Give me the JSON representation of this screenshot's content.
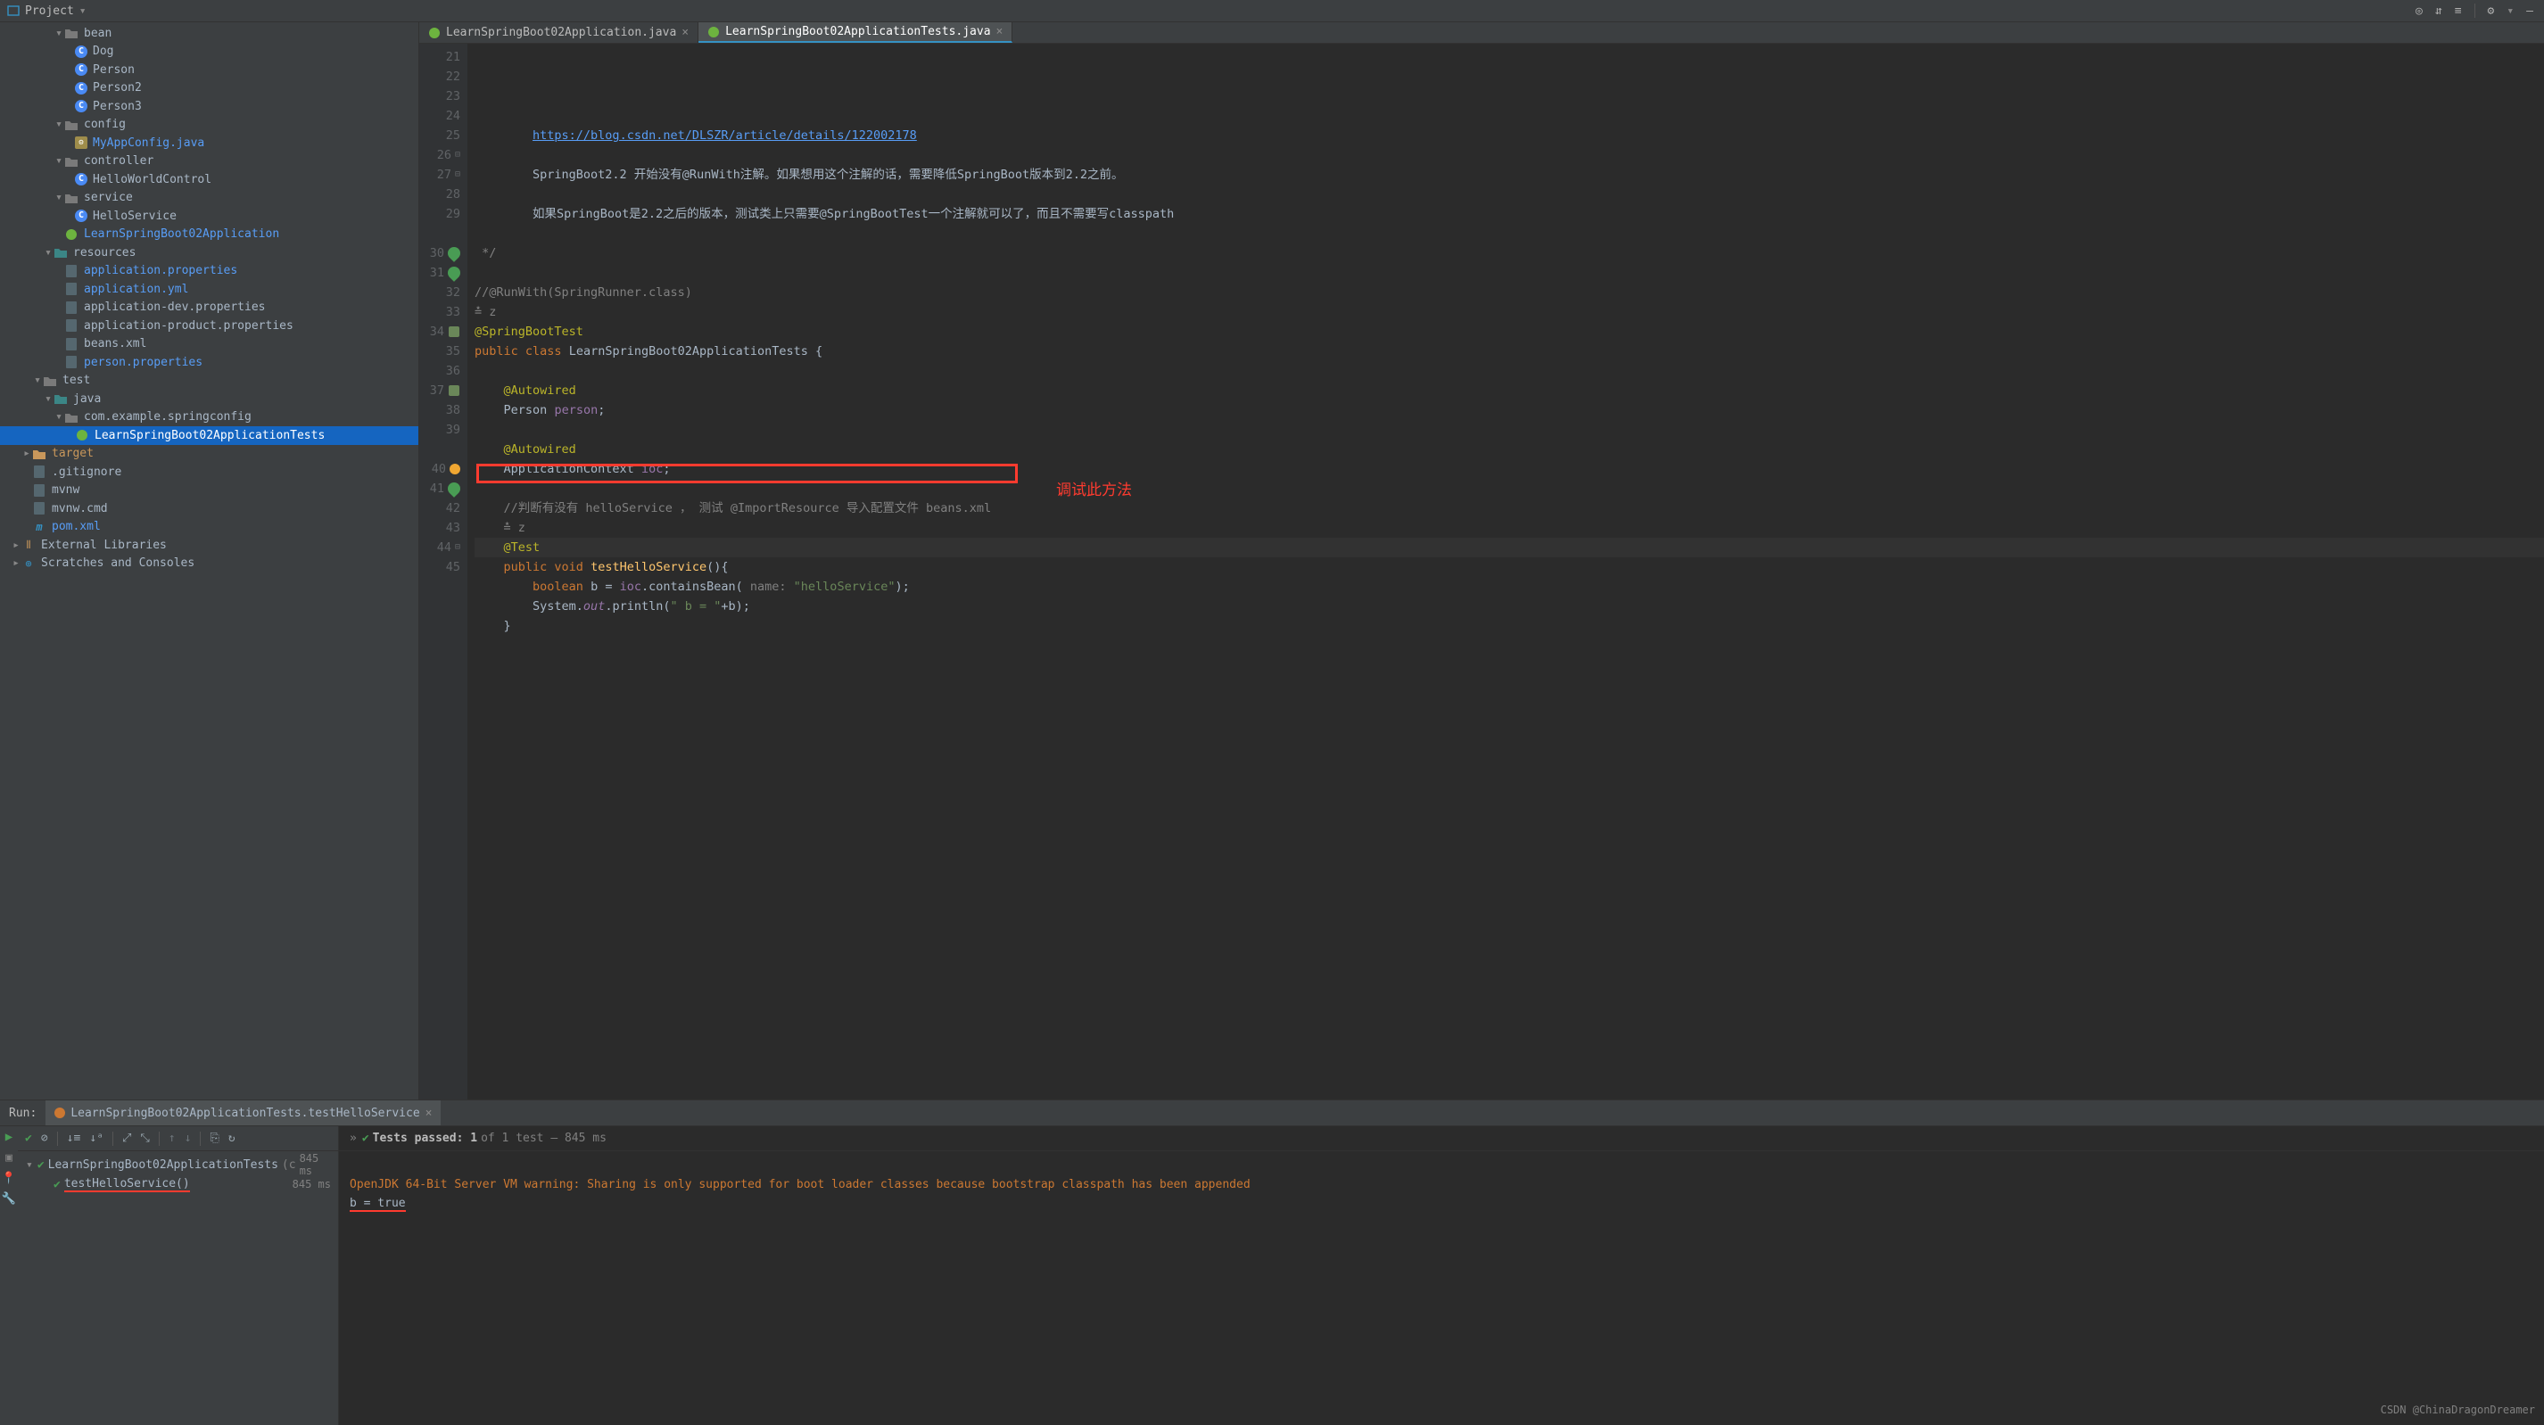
{
  "topbar": {
    "project_label": "Project"
  },
  "project_tree": {
    "items": [
      {
        "depth": 4,
        "caret": "v",
        "icoCls": "fi-dir",
        "label": "bean"
      },
      {
        "depth": 5,
        "caret": "",
        "icoCls": "fi-class",
        "label": "Dog"
      },
      {
        "depth": 5,
        "caret": "",
        "icoCls": "fi-class",
        "label": "Person"
      },
      {
        "depth": 5,
        "caret": "",
        "icoCls": "fi-class",
        "label": "Person2"
      },
      {
        "depth": 5,
        "caret": "",
        "icoCls": "fi-class",
        "label": "Person3"
      },
      {
        "depth": 4,
        "caret": "v",
        "icoCls": "fi-dir",
        "label": "config"
      },
      {
        "depth": 5,
        "caret": "",
        "icoCls": "fi-cfg",
        "label": "MyAppConfig.java",
        "labelCls": "hl-blue"
      },
      {
        "depth": 4,
        "caret": "v",
        "icoCls": "fi-dir",
        "label": "controller"
      },
      {
        "depth": 5,
        "caret": "",
        "icoCls": "fi-class",
        "label": "HelloWorldControl"
      },
      {
        "depth": 4,
        "caret": "v",
        "icoCls": "fi-dir",
        "label": "service"
      },
      {
        "depth": 5,
        "caret": "",
        "icoCls": "fi-class",
        "label": "HelloService"
      },
      {
        "depth": 4,
        "caret": "",
        "icoCls": "fi-class",
        "label": "LearnSpringBoot02Application",
        "labelCls": "hl-blue",
        "greenIco": true
      },
      {
        "depth": 3,
        "caret": "v",
        "icoCls": "fi-dir src",
        "label": "resources"
      },
      {
        "depth": 4,
        "caret": "",
        "icoCls": "fi-res",
        "label": "application.properties",
        "labelCls": "hl-blue"
      },
      {
        "depth": 4,
        "caret": "",
        "icoCls": "fi-res",
        "label": "application.yml",
        "labelCls": "hl-blue"
      },
      {
        "depth": 4,
        "caret": "",
        "icoCls": "fi-res",
        "label": "application-dev.properties"
      },
      {
        "depth": 4,
        "caret": "",
        "icoCls": "fi-res",
        "label": "application-product.properties"
      },
      {
        "depth": 4,
        "caret": "",
        "icoCls": "fi-res",
        "label": "beans.xml"
      },
      {
        "depth": 4,
        "caret": "",
        "icoCls": "fi-res",
        "label": "person.properties",
        "labelCls": "hl-blue"
      },
      {
        "depth": 2,
        "caret": "v",
        "icoCls": "fi-dir",
        "label": "test"
      },
      {
        "depth": 3,
        "caret": "v",
        "icoCls": "fi-dir src",
        "label": "java"
      },
      {
        "depth": 4,
        "caret": "v",
        "icoCls": "fi-dir",
        "label": "com.example.springconfig"
      },
      {
        "depth": 5,
        "caret": "",
        "icoCls": "fi-class",
        "label": "LearnSpringBoot02ApplicationTests",
        "selected": true,
        "greenIco": true
      },
      {
        "depth": 1,
        "caret": ">",
        "icoCls": "fi-dir",
        "label": "target",
        "labelCls": "hl-tan"
      },
      {
        "depth": 1,
        "caret": "",
        "icoCls": "",
        "label": ".gitignore"
      },
      {
        "depth": 1,
        "caret": "",
        "icoCls": "",
        "label": "mvnw"
      },
      {
        "depth": 1,
        "caret": "",
        "icoCls": "",
        "label": "mvnw.cmd"
      },
      {
        "depth": 1,
        "caret": "",
        "icoCls": "",
        "label": "pom.xml",
        "labelCls": "hl-blue",
        "mvn": true
      },
      {
        "depth": 0,
        "caret": ">",
        "icoCls": "",
        "label": "External Libraries",
        "lib": true
      },
      {
        "depth": 0,
        "caret": ">",
        "icoCls": "",
        "label": "Scratches and Consoles",
        "scratch": true
      }
    ]
  },
  "editor": {
    "tabs": [
      {
        "label": "LearnSpringBoot02Application.java",
        "active": false
      },
      {
        "label": "LearnSpringBoot02ApplicationTests.java",
        "active": true
      }
    ],
    "gutter_start": 21,
    "lines": [
      {
        "n": 21,
        "html": "        <span class='lnk'>https://blog.csdn.net/DLSZR/article/details/122002178</span>"
      },
      {
        "n": 22,
        "html": ""
      },
      {
        "n": 23,
        "html": "        SpringBoot2.2 开始没有@RunWith注解。如果想用这个注解的话，需要降低SpringBoot版本到2.2之前。"
      },
      {
        "n": 24,
        "html": ""
      },
      {
        "n": 25,
        "html": "        如果SpringBoot是2.2之后的版本，测试类上只需要@SpringBootTest一个注解就可以了，而且不需要写classpath"
      },
      {
        "n": 26,
        "html": "",
        "gut": "fold"
      },
      {
        "n": 27,
        "html": " <span class='cmt'>*/</span>",
        "gut": "fold"
      },
      {
        "n": 28,
        "html": ""
      },
      {
        "n": 29,
        "html": "<span class='cmt'>//@RunWith(SpringRunner.class)</span>"
      },
      {
        "n": "",
        "html": "<span class='hint'>≛ z</span>"
      },
      {
        "n": 30,
        "html": "<span class='ann'>@SpringBootTest</span>",
        "gut": "leaf"
      },
      {
        "n": 31,
        "html": "<span class='kw'>public class</span> <span class='cls'>LearnSpringBoot02ApplicationTests</span> {",
        "gut": "leafrun"
      },
      {
        "n": 32,
        "html": ""
      },
      {
        "n": 33,
        "html": "    <span class='ann'>@Autowired</span>"
      },
      {
        "n": 34,
        "html": "    <span class='cls'>Person</span> <span class='fld'>person</span>;",
        "gut": "leafcls"
      },
      {
        "n": 35,
        "html": ""
      },
      {
        "n": 36,
        "html": "    <span class='ann'>@Autowired</span>"
      },
      {
        "n": 37,
        "html": "    <span class='cls'>ApplicationContext</span> <span class='fld'>ioc</span>;",
        "gut": "leafcls"
      },
      {
        "n": 38,
        "html": ""
      },
      {
        "n": 39,
        "html": "    <span class='cmt'>//判断有没有 helloService ， 测试 @ImportResource 导入配置文件 beans.xml</span>"
      },
      {
        "n": "",
        "html": "    <span class='hint'>≛ z</span>"
      },
      {
        "n": 40,
        "html": "    <span class='ann'>@Test</span>",
        "cur": true,
        "gut": "bulb"
      },
      {
        "n": 41,
        "html": "    <span class='kw'>public void</span> <span class='mth'>testHelloService</span>(){",
        "gut": "leafrun"
      },
      {
        "n": 42,
        "html": "        <span class='kw'>boolean</span> b = <span class='fld'>ioc</span>.containsBean( <span class='hint'>name:</span> <span class='str'>\"helloService\"</span>);"
      },
      {
        "n": 43,
        "html": "        System.<span class='fldit'>out</span>.println(<span class='str'>\" b = \"</span>+b);"
      },
      {
        "n": 44,
        "html": "    }",
        "gut": "fold"
      },
      {
        "n": 45,
        "html": ""
      }
    ],
    "annotation": "调试此方法"
  },
  "run": {
    "header_label": "Run:",
    "tab_label": "LearnSpringBoot02ApplicationTests.testHelloService",
    "tests_passed_prefix": "Tests passed: 1",
    "tests_passed_suffix": " of 1 test – 845 ms",
    "tree": [
      {
        "depth": 0,
        "label": "LearnSpringBoot02ApplicationTests",
        "suffix": "(c",
        "dur": "845 ms",
        "caret": "v"
      },
      {
        "depth": 1,
        "label": "testHelloService()",
        "dur": "845 ms",
        "underline": true
      }
    ],
    "console": {
      "warn": "OpenJDK 64-Bit Server VM warning: Sharing is only supported for boot loader classes because bootstrap classpath has been appended",
      "out": "b = true"
    },
    "watermark": "CSDN @ChinaDragonDreamer"
  }
}
